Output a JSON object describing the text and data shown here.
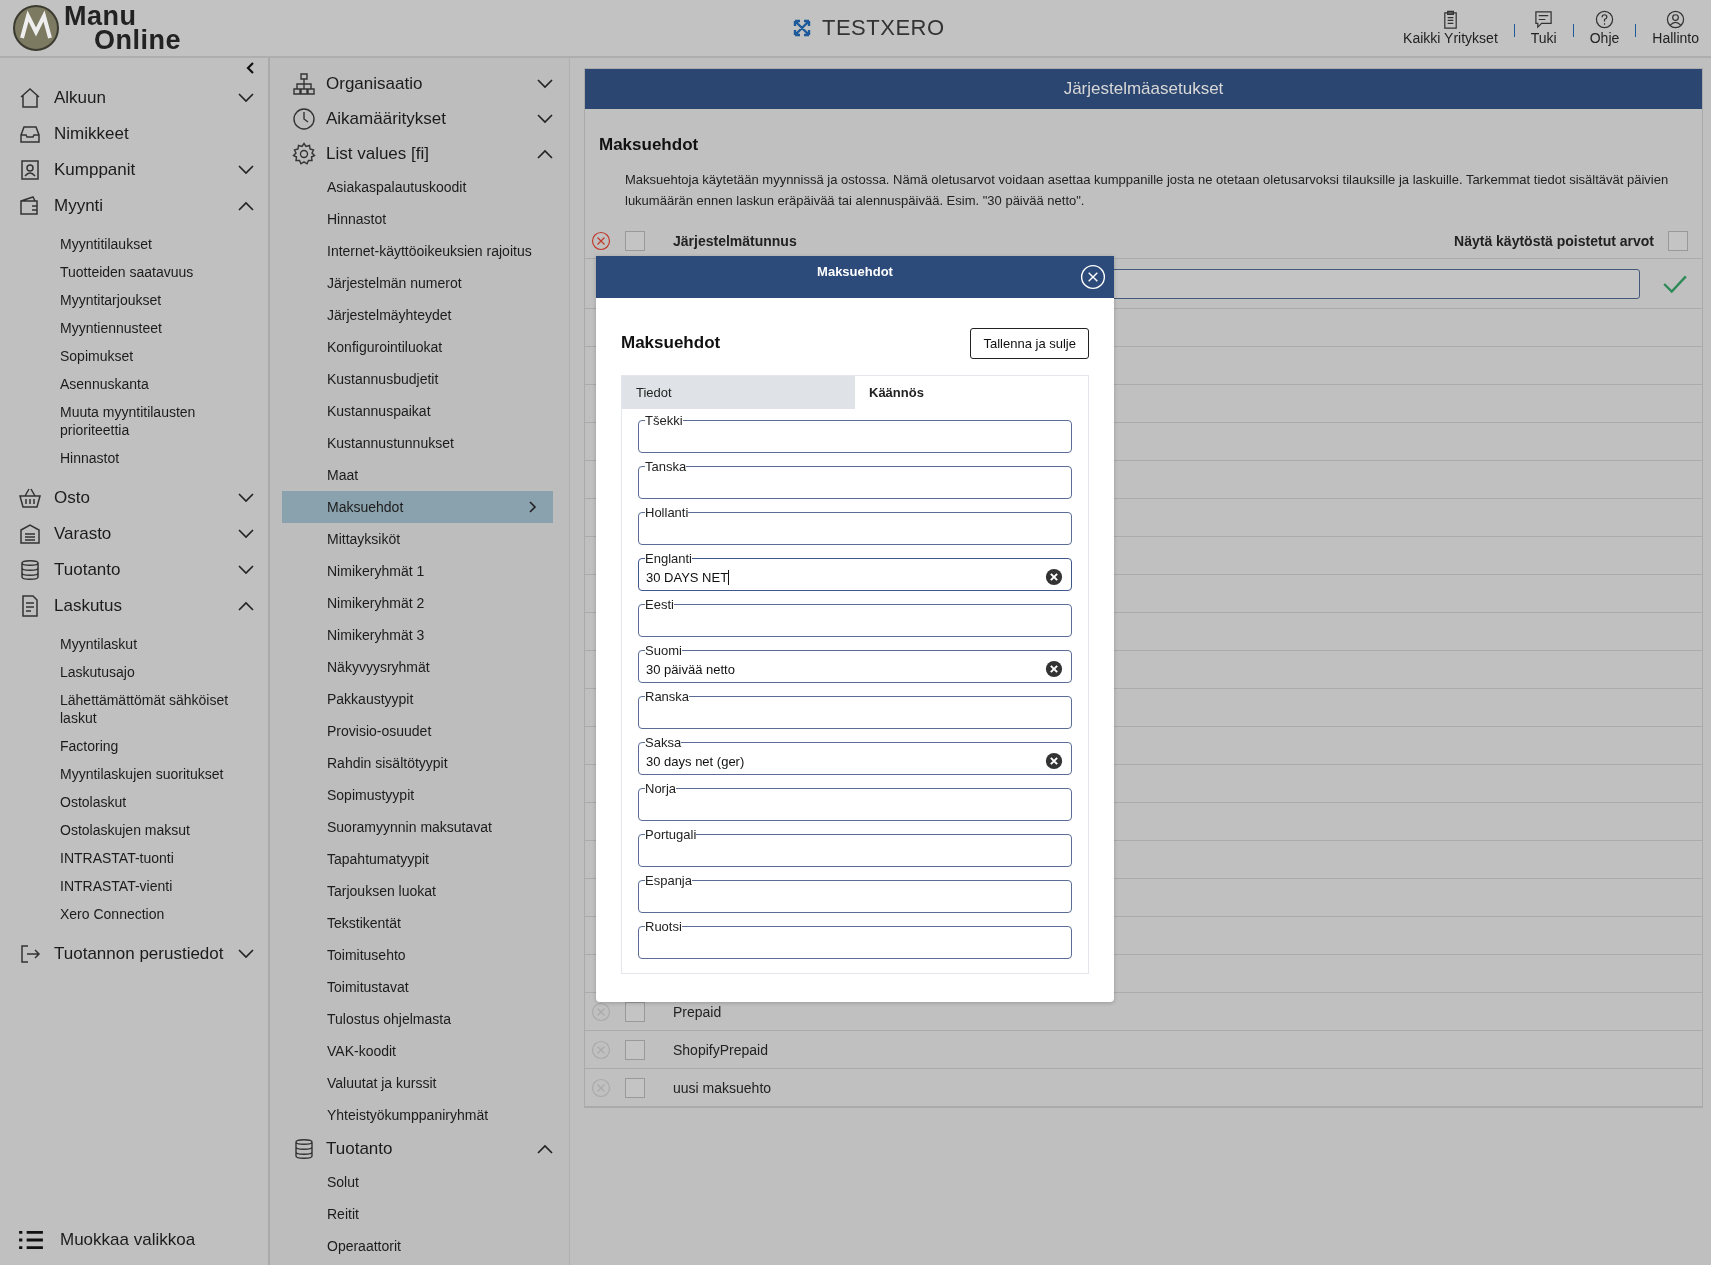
{
  "header": {
    "logo_text": [
      "Manu",
      "Online"
    ],
    "company": "TESTXERO",
    "links": [
      {
        "label": "Kaikki Yritykset"
      },
      {
        "label": "Tuki"
      },
      {
        "label": "Ohje"
      },
      {
        "label": "Hallinto"
      }
    ]
  },
  "sidebar": {
    "items": [
      {
        "label": "Alkuun",
        "expanded": false
      },
      {
        "label": "Nimikkeet"
      },
      {
        "label": "Kumppanit",
        "expanded": false
      },
      {
        "label": "Myynti",
        "expanded": true,
        "children": [
          "Myyntitilaukset",
          "Tuotteiden saatavuus",
          "Myyntitarjoukset",
          "Myyntiennusteet",
          "Sopimukset",
          "Asennuskanta",
          "Muuta myyntitilausten prioriteettia",
          "Hinnastot"
        ]
      },
      {
        "label": "Osto",
        "expanded": false
      },
      {
        "label": "Varasto",
        "expanded": false
      },
      {
        "label": "Tuotanto",
        "expanded": false
      },
      {
        "label": "Laskutus",
        "expanded": true,
        "children": [
          "Myyntilaskut",
          "Laskutusajo",
          "Lähettämättömät sähköiset laskut",
          "Factoring",
          "Myyntilaskujen suoritukset",
          "Ostolaskut",
          "Ostolaskujen maksut",
          "INTRASTAT-tuonti",
          "INTRASTAT-vienti",
          "Xero Connection"
        ]
      },
      {
        "label": "Tuotannon perustiedot",
        "expanded": false
      }
    ],
    "footer": "Muokkaa valikkoa"
  },
  "settings_nav": {
    "items": [
      {
        "label": "Organisaatio",
        "expanded": false
      },
      {
        "label": "Aikamääritykset",
        "expanded": false
      },
      {
        "label": "List values [fi]",
        "expanded": true,
        "children": [
          {
            "label": "Asiakaspalautuskoodit",
            "selected": false
          },
          {
            "label": "Hinnastot",
            "selected": false
          },
          {
            "label": "Internet-käyttöoikeuksien rajoitus",
            "selected": false
          },
          {
            "label": "Järjestelmän numerot",
            "selected": false
          },
          {
            "label": "Järjestelmäyhteydet",
            "selected": false
          },
          {
            "label": "Konfigurointiluokat",
            "selected": false
          },
          {
            "label": "Kustannusbudjetit",
            "selected": false
          },
          {
            "label": "Kustannuspaikat",
            "selected": false
          },
          {
            "label": "Kustannustunnukset",
            "selected": false
          },
          {
            "label": "Maat",
            "selected": false
          },
          {
            "label": "Maksuehdot",
            "selected": true
          },
          {
            "label": "Mittayksiköt",
            "selected": false
          },
          {
            "label": "Nimikeryhmät 1",
            "selected": false
          },
          {
            "label": "Nimikeryhmät 2",
            "selected": false
          },
          {
            "label": "Nimikeryhmät 3",
            "selected": false
          },
          {
            "label": "Näkyvyysryhmät",
            "selected": false
          },
          {
            "label": "Pakkaustyypit",
            "selected": false
          },
          {
            "label": "Provisio-osuudet",
            "selected": false
          },
          {
            "label": "Rahdin sisältötyypit",
            "selected": false
          },
          {
            "label": "Sopimustyypit",
            "selected": false
          },
          {
            "label": "Suoramyynnin maksutavat",
            "selected": false
          },
          {
            "label": "Tapahtumatyypit",
            "selected": false
          },
          {
            "label": "Tarjouksen luokat",
            "selected": false
          },
          {
            "label": "Tekstikentät",
            "selected": false
          },
          {
            "label": "Toimitusehto",
            "selected": false
          },
          {
            "label": "Toimitustavat",
            "selected": false
          },
          {
            "label": "Tulostus ohjelmasta",
            "selected": false
          },
          {
            "label": "VAK-koodit",
            "selected": false
          },
          {
            "label": "Valuutat ja kurssit",
            "selected": false
          },
          {
            "label": "Yhteistyökumppaniryhmät",
            "selected": false
          }
        ]
      },
      {
        "label": "Tuotanto",
        "expanded": true,
        "children": [
          {
            "label": "Solut",
            "selected": false
          },
          {
            "label": "Reitit",
            "selected": false
          },
          {
            "label": "Operaattorit",
            "selected": false
          }
        ]
      }
    ]
  },
  "panel": {
    "title": "Järjestelmäasetukset",
    "section_title": "Maksuehdot",
    "description": "Maksuehtoja käytetään myynnissä ja ostossa. Nämä oletusarvot voidaan asettaa kumppanille josta ne otetaan oletusarvoksi tilauksille ja laskuille. Tarkemmat tiedot sisältävät päivien lukumäärän ennen laskun eräpäivää tai alennuspäivää. Esim. \"30 päivää netto\".",
    "header_checked": false,
    "column": "Järjestelmätunnus",
    "show_deleted": {
      "label": "Näytä käytöstä poistetut arvot",
      "checked": false
    },
    "rows": [
      {
        "label": "Prepaid",
        "checked": false
      },
      {
        "label": "ShopifyPrepaid",
        "checked": false
      },
      {
        "label": "uusi maksuehto",
        "checked": false
      }
    ]
  },
  "dialog": {
    "title": "Maksuehdot",
    "heading": "Maksuehdot",
    "save_button": "Tallenna ja sulje",
    "tabs": [
      {
        "label": "Tiedot",
        "selected": false
      },
      {
        "label": "Käännös",
        "selected": true
      }
    ],
    "fields": [
      {
        "label": "Tšekki",
        "focused": false
      },
      {
        "label": "Tanska",
        "focused": false
      },
      {
        "label": "Hollanti",
        "focused": false
      },
      {
        "label": "Englanti",
        "value": "30 DAYS NET",
        "focused": true
      },
      {
        "label": "Eesti",
        "focused": false
      },
      {
        "label": "Suomi",
        "value": "30 päivää netto",
        "focused": false
      },
      {
        "label": "Ranska",
        "focused": false
      },
      {
        "label": "Saksa",
        "value": "30 days net (ger)",
        "focused": false
      },
      {
        "label": "Norja",
        "focused": false
      },
      {
        "label": "Portugali",
        "focused": false
      },
      {
        "label": "Espanja",
        "focused": false
      },
      {
        "label": "Ruotsi",
        "focused": false
      }
    ]
  }
}
